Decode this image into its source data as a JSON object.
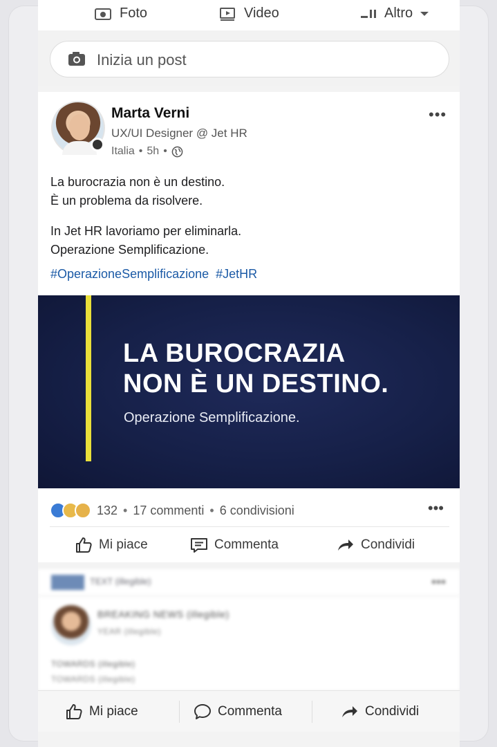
{
  "composer": {
    "actions": [
      {
        "label": "Foto",
        "icon": "photo-icon"
      },
      {
        "label": "Video",
        "icon": "video-icon"
      },
      {
        "label": "Altro",
        "icon": "more-options-icon"
      }
    ],
    "placeholder": "Inizia un post"
  },
  "post": {
    "author": {
      "name": "Marta Verni",
      "title": "UX/UI Designer @ Jet HR",
      "location": "Italia",
      "time": "5h",
      "sep": "•"
    },
    "text": {
      "p1_line1": "La burocrazia non è un destino.",
      "p1_line2": "È un problema da risolvere.",
      "p2_line1": "In Jet HR lavoriamo per eliminarla.",
      "p2_line2": "Operazione Semplificazione."
    },
    "hashtags": [
      "#OperazioneSemplificazione",
      "#JetHR"
    ],
    "banner": {
      "headline_line1": "LA BUROCRAZIA",
      "headline_line2": "NON È UN DESTINO.",
      "subtitle": "Operazione Semplificazione.",
      "accent_color": "#e9df3a",
      "background_color": "#162048"
    },
    "stats": {
      "reactions": "132",
      "comments": "17 commenti",
      "shares": "6 condivisioni",
      "sep": "•"
    },
    "actions": {
      "like": "Mi piace",
      "comment": "Commenta",
      "share": "Condividi"
    }
  },
  "next_post": {
    "header": "TEXT (illegible)",
    "line1": "BREAKING NEWS (illegible)",
    "line2": "YEAR (illegible)",
    "line3": "TOWARDS (illegible)",
    "line4": "TOWARDS (illegible)",
    "actions": {
      "like": "Mi piace",
      "comment": "Commenta",
      "share": "Condividi"
    }
  },
  "colors": {
    "hashtag": "#1b5aa6",
    "like_reaction": "#3a7bd5"
  }
}
